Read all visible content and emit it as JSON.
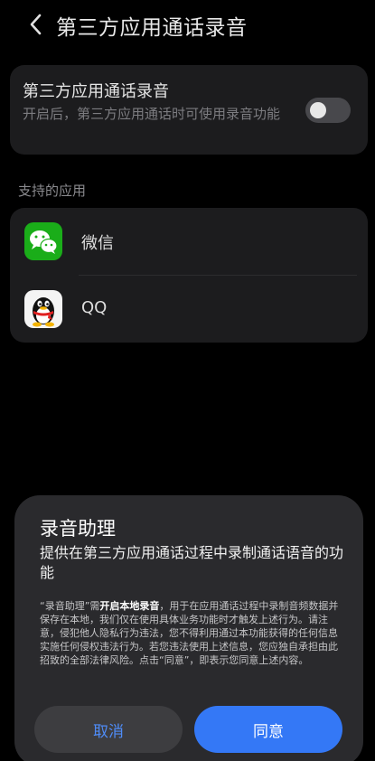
{
  "header": {
    "title": "第三方应用通话录音"
  },
  "setting": {
    "title": "第三方应用通话录音",
    "description": "开启后，第三方应用通话时可使用录音功能",
    "toggle_state": "off"
  },
  "supported": {
    "section_label": "支持的应用",
    "apps": [
      {
        "name": "微信",
        "icon": "wechat-icon"
      },
      {
        "name": "QQ",
        "icon": "qq-icon"
      }
    ]
  },
  "dialog": {
    "title": "录音助理",
    "subtitle": "提供在第三方应用通话过程中录制通话语音的功能",
    "body_prefix": "“录音助理”需",
    "body_bold": "开启本地录音",
    "body_suffix": "，用于在应用通话过程中录制音频数据并保存在本地，我们仅在使用具体业务功能时才触发上述行为。请注意，侵犯他人隐私行为违法，您不得利用通过本功能获得的任何信息实施任何侵权违法行为。若您违法使用上述信息，您应独自承担由此招致的全部法律风险。点击“同意”，即表示您同意上述内容。",
    "cancel_label": "取消",
    "agree_label": "同意"
  },
  "colors": {
    "accent": "#3478f6",
    "background": "#000000",
    "card": "#1c1c1e",
    "dialog": "#2a2a2d"
  }
}
